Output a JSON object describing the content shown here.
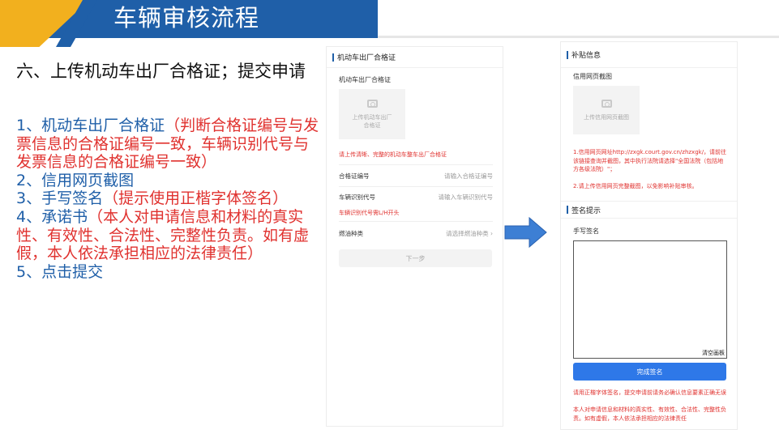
{
  "slide": {
    "title": "车辆审核流程",
    "step_title": "六、上传机动车出厂合格证；提交申请",
    "items": [
      {
        "text": "1、机动车出厂合格证",
        "color": "#1f5fa8"
      },
      {
        "text": "（判断合格证编号与发票信息的合格证编号一致，车辆识别代号与发票信息的合格证编号一致）",
        "color": "#e0322f"
      },
      {
        "text": "2、信用网页截图",
        "color": "#1f5fa8"
      },
      {
        "text": "3、手写签名",
        "color": "#1f5fa8"
      },
      {
        "text": "（提示使用正楷字体签名）",
        "color": "#e0322f"
      },
      {
        "text": "4、承诺书",
        "color": "#1f5fa8"
      },
      {
        "text": "（本人对申请信息和材料的真实性、有效性、合法性、完整性负责。如有虚假，本人依法承担相应的法律责任）",
        "color": "#e0322f"
      },
      {
        "text": "5、点击提交",
        "color": "#1f5fa8"
      }
    ]
  },
  "phone1": {
    "section_title": "机动车出厂合格证",
    "field_label": "机动车出厂合格证",
    "upload_text": "上传机动车出厂合格证",
    "hint": "请上传清晰、完整的机动车整车出厂合格证",
    "cert_no_label": "合格证编号",
    "cert_no_placeholder": "请输入合格证编号",
    "vin_label": "车辆识别代号",
    "vin_placeholder": "请输入车辆识别代号",
    "vin_hint": "车辆识别代号需L/H开头",
    "fuel_label": "燃油种类",
    "fuel_placeholder": "请选择燃油种类 ›",
    "next_button": "下一步"
  },
  "phone2": {
    "section1_title": "补贴信息",
    "credit_label": "信用网页截图",
    "upload_text": "上传信用网页截图",
    "note1": "1.信用网页网址http://zxgk.court.gov.cn/zhzxgk/，请前往该链接查询并截图，其中执行法院请选择\"全国法院（包括地方各级法院）\"；",
    "note2": "2.请上传信用网页完整截图，以免影响补贴审核。",
    "section2_title": "签名提示",
    "signature_label": "手写签名",
    "clear_button": "清空画板",
    "finish_button": "完成签名",
    "bottom_note1": "请用正楷字体签名，提交申请前请务必确认信息要素正确无误",
    "bottom_note2": "本人对申请信息和材料的真实性、有效性、合法性、完整性负责。如有虚假，本人依法承担相应的法律责任"
  },
  "colors": {
    "brand_blue": "#1f5fa8",
    "accent_yellow": "#f2b01e",
    "warn_red": "#e0322f",
    "button_blue": "#2e78e8"
  }
}
